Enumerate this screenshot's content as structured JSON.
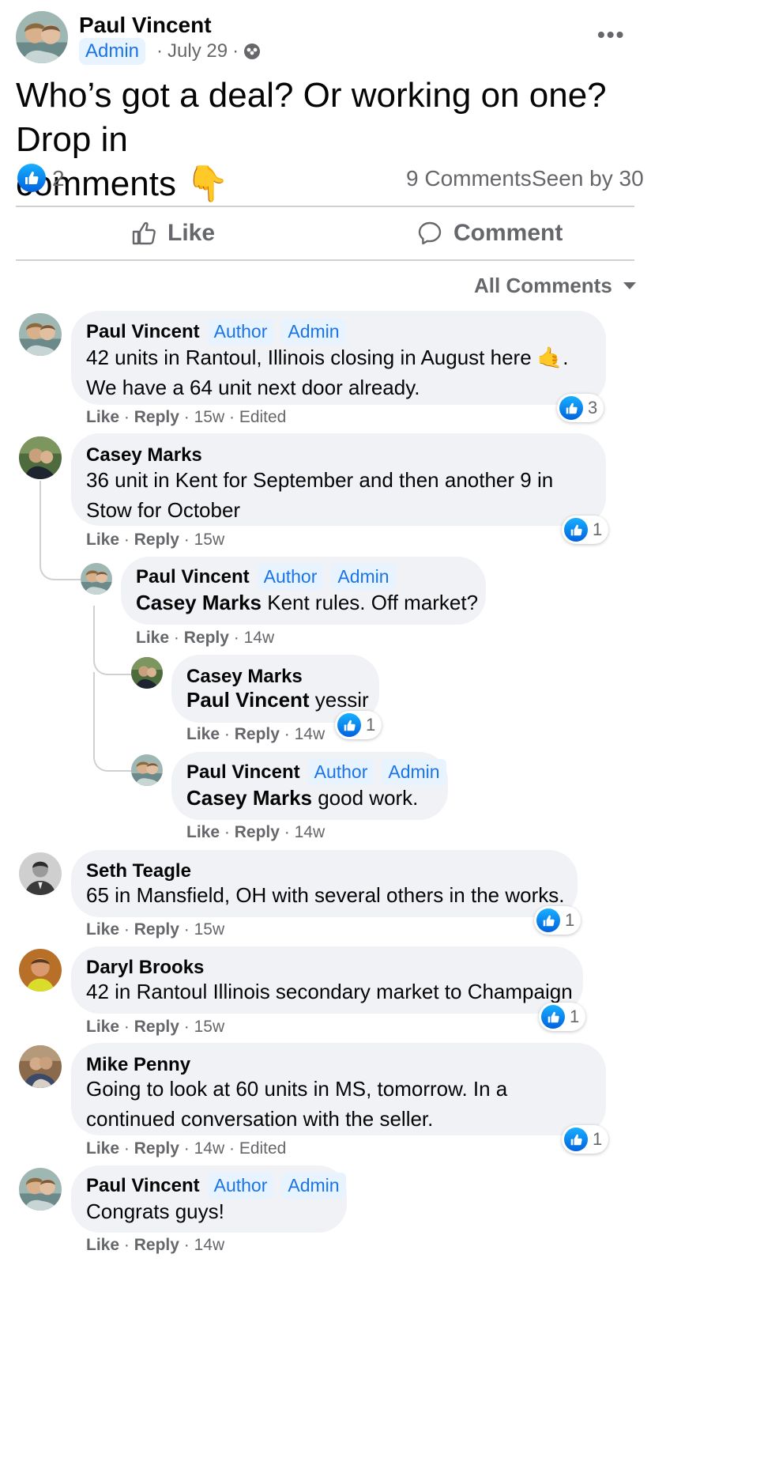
{
  "post": {
    "author": "Paul Vincent",
    "badge": "Admin",
    "date": "July 29",
    "sep": "·",
    "more": "•••",
    "text": "Who’s got a deal? Or working on one? Drop in comments 👇",
    "text_line1": "Who’s got a deal? Or working on one? Drop in",
    "text_line2": "comments",
    "emoji": "👇",
    "like_count": "2",
    "comments_count": "9 Comments",
    "seen_by": "Seen by 30"
  },
  "actions": {
    "like": "Like",
    "comment": "Comment"
  },
  "sort": {
    "label": "All Comments"
  },
  "labels": {
    "like": "Like",
    "reply": "Reply",
    "author": "Author",
    "admin": "Admin",
    "dot": "·"
  },
  "comments": [
    {
      "name": "Paul Vincent",
      "line1": "42 units in Rantoul, Illinois closing in August here 🤙.",
      "line2": "We have a 64 unit next door already.",
      "time": "15w",
      "edited": "Edited",
      "reactions": "3"
    },
    {
      "name": "Casey Marks",
      "line1": "36 unit in Kent for September and then another 9 in",
      "line2": "Stow for October",
      "time": "15w",
      "reactions": "1"
    },
    {
      "name": "Paul Vincent",
      "mention": "Casey Marks",
      "text": " Kent rules. Off market?",
      "time": "14w"
    },
    {
      "name": "Casey Marks",
      "mention": "Paul Vincent",
      "text": " yessir",
      "time": "14w",
      "reactions": "1"
    },
    {
      "name": "Paul Vincent",
      "mention": "Casey Marks",
      "text": " good work.",
      "time": "14w"
    },
    {
      "name": "Seth Teagle",
      "line1": "65 in Mansfield, OH with several others in the works.",
      "time": "15w",
      "reactions": "1"
    },
    {
      "name": "Daryl Brooks",
      "line1": "42 in Rantoul Illinois secondary market to Champaign",
      "time": "15w",
      "reactions": "1"
    },
    {
      "name": "Mike Penny",
      "line1": "Going to look at 60 units in MS, tomorrow. In a",
      "line2": "continued conversation with the seller.",
      "time": "14w",
      "edited": "Edited",
      "reactions": "1"
    },
    {
      "name": "Paul Vincent",
      "line1": "Congrats guys!",
      "time": "14w"
    }
  ],
  "colors": {
    "accent": "#1b74e4",
    "bubble": "#f0f2f5",
    "secondary": "#65676b"
  }
}
